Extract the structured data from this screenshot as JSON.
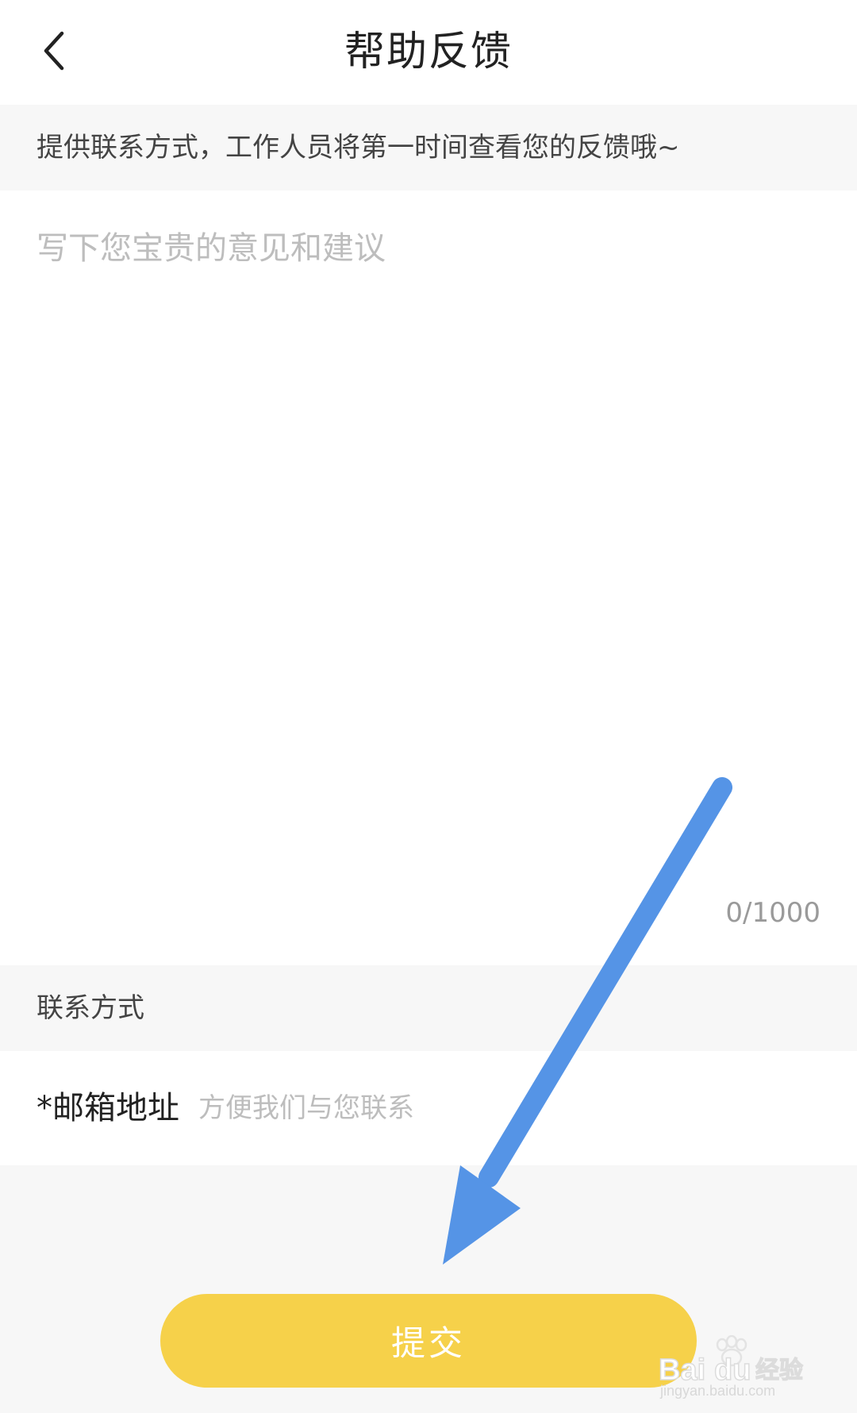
{
  "header": {
    "title": "帮助反馈",
    "back_icon": "chevron-left-icon"
  },
  "hint": {
    "text": "提供联系方式，工作人员将第一时间查看您的反馈哦~"
  },
  "feedback": {
    "placeholder": "写下您宝贵的意见和建议",
    "value": "",
    "counter": "0/1000"
  },
  "contact": {
    "section_title": "联系方式",
    "email_label": "*邮箱地址",
    "email_placeholder": "方便我们与您联系",
    "email_value": ""
  },
  "submit": {
    "label": "提交"
  },
  "watermark": {
    "brand": "Baidu经验",
    "url": "jingyan.baidu.com"
  },
  "colors": {
    "accent": "#f6d14a",
    "annotation_arrow": "#5594e6",
    "background": "#f7f7f7"
  }
}
